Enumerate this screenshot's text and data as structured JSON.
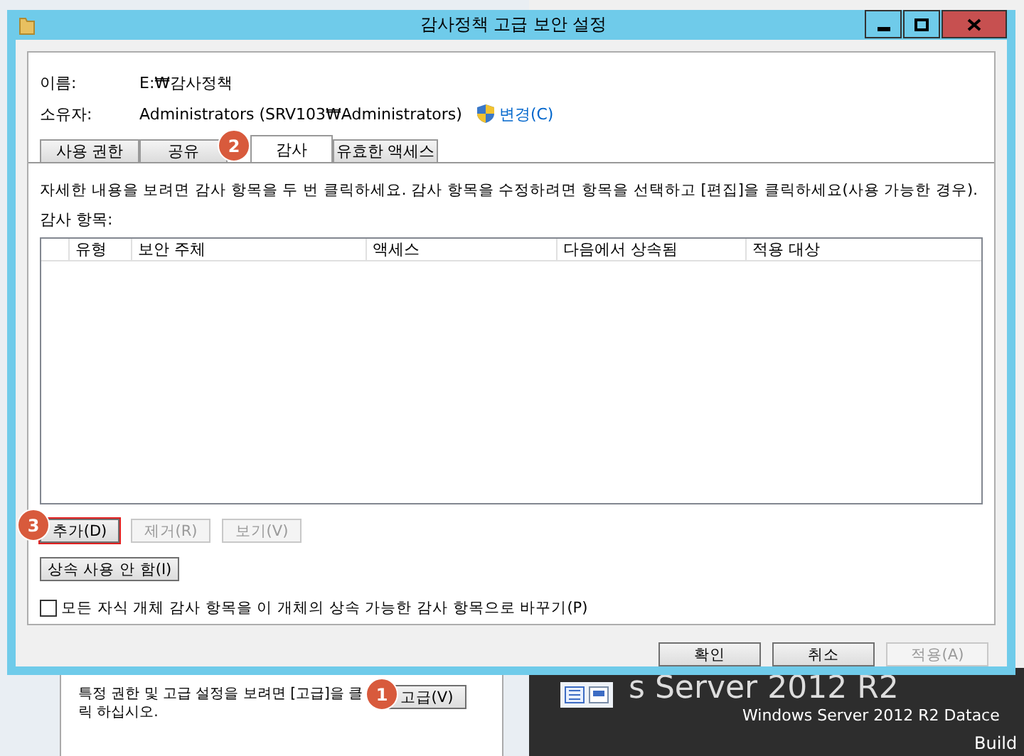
{
  "window": {
    "title": "감사정책 고급 보안 설정"
  },
  "name": {
    "label": "이름:",
    "value": "E:₩감사정책"
  },
  "owner": {
    "label": "소유자:",
    "value": "Administrators (SRV103₩Administrators)",
    "link": "변경(C)"
  },
  "tabs": [
    {
      "label": "사용 권한",
      "selected": false
    },
    {
      "label": "공유",
      "selected": false
    },
    {
      "label": "감사",
      "selected": true
    },
    {
      "label": "유효한 액세스",
      "selected": false
    }
  ],
  "instruction": "자세한 내용을 보려면 감사 항목을 두 번 클릭하세요. 감사 항목을 수정하려면 항목을 선택하고 [편집]을 클릭하세요(사용 가능한 경우).",
  "list": {
    "label": "감사 항목:",
    "columns": [
      "유형",
      "보안 주체",
      "액세스",
      "다음에서 상속됨",
      "적용 대상"
    ]
  },
  "list_buttons": [
    {
      "label": "추가(D)",
      "disabled": false,
      "highlighted": true
    },
    {
      "label": "제거(R)",
      "disabled": true,
      "highlighted": false
    },
    {
      "label": "보기(V)",
      "disabled": true,
      "highlighted": false
    }
  ],
  "inherit_button": "상속 사용 안 함(I)",
  "replace_checkbox": {
    "label": "모든 자식 개체 감사 항목을 이 개체의 상속 가능한 감사 항목으로 바꾸기(P)",
    "checked": false
  },
  "footer_buttons": [
    {
      "label": "확인",
      "disabled": false
    },
    {
      "label": "취소",
      "disabled": false
    },
    {
      "label": "적용(A)",
      "disabled": true
    }
  ],
  "background_window": {
    "text": "특정 권한 및 고급 설정을 보려면 [고급]을 클릭 하십시오.",
    "button": "고급(V)"
  },
  "desktop": {
    "texts": [
      "s Server 2012 R2",
      "Windows Server 2012 R2 Datace",
      "Build"
    ]
  },
  "callouts": [
    "1",
    "2",
    "3"
  ]
}
